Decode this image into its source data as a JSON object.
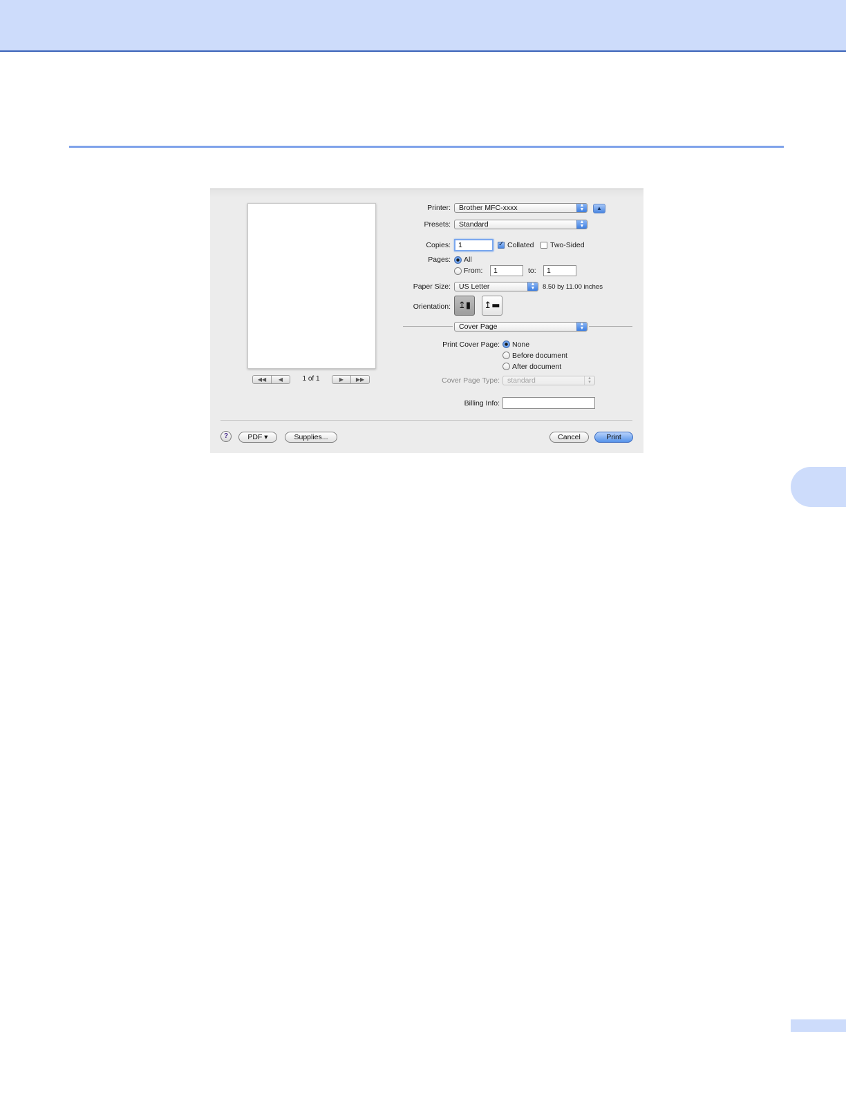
{
  "dialog": {
    "preview": {
      "page_count": "1 of 1",
      "nav_first_label": "◀◀",
      "nav_prev_label": "◀",
      "nav_next_label": "▶",
      "nav_last_label": "▶▶"
    },
    "printer": {
      "label": "Printer:",
      "value": "Brother MFC-xxxx",
      "disclosure_symbol": "▲"
    },
    "presets": {
      "label": "Presets:",
      "value": "Standard"
    },
    "copies": {
      "label": "Copies:",
      "value": "1",
      "collated_label": "Collated",
      "collated": true,
      "two_sided_label": "Two-Sided",
      "two_sided": false
    },
    "pages": {
      "label": "Pages:",
      "all_label": "All",
      "from_label": "From:",
      "from_value": "1",
      "to_label": "to:",
      "to_value": "1",
      "selected": "All"
    },
    "paper_size": {
      "label": "Paper Size:",
      "value": "US Letter",
      "dimensions": "8.50 by 11.00 inches"
    },
    "orientation": {
      "label": "Orientation:",
      "portrait_glyph": "⬆︎🚹",
      "selected": "portrait"
    },
    "panel_select": {
      "value": "Cover Page"
    },
    "cover_page": {
      "label": "Print Cover Page:",
      "options": [
        "None",
        "Before document",
        "After document"
      ],
      "selected": "None",
      "type_label": "Cover Page Type:",
      "type_value": "standard",
      "billing_label": "Billing Info:",
      "billing_value": ""
    },
    "footer": {
      "help_label": "?",
      "pdf_label": "PDF ▾",
      "supplies_label": "Supplies...",
      "cancel_label": "Cancel",
      "print_label": "Print"
    }
  },
  "colors": {
    "header_band": "#cddcfb",
    "accent_rule": "#7fa2ea",
    "accent_blue": "#3f7fe0"
  }
}
